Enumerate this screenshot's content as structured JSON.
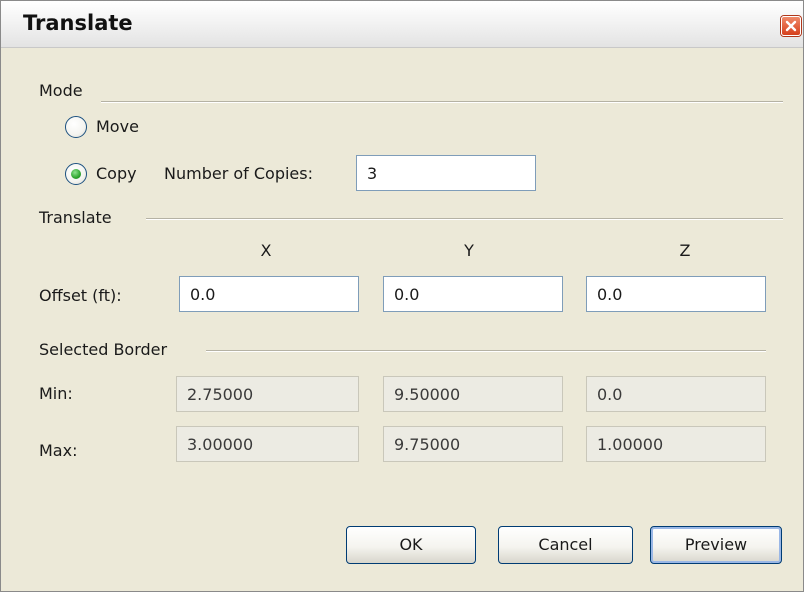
{
  "window": {
    "title": "Translate",
    "close_icon": "close-icon"
  },
  "mode": {
    "group_label": "Mode",
    "move_label": "Move",
    "copy_label": "Copy",
    "selected": "copy",
    "copies_label": "Number of Copies:",
    "copies_value": "3"
  },
  "translate": {
    "group_label": "Translate",
    "axes": [
      "X",
      "Y",
      "Z"
    ],
    "offset_label": "Offset (ft):",
    "offset_values": [
      "0.0",
      "0.0",
      "0.0"
    ]
  },
  "selected_border": {
    "group_label": "Selected Border",
    "min_label": "Min:",
    "min_values": [
      "2.75000",
      "9.50000",
      "0.0"
    ],
    "max_label": "Max:",
    "max_values": [
      "3.00000",
      "9.75000",
      "1.00000"
    ]
  },
  "buttons": {
    "ok": "OK",
    "cancel": "Cancel",
    "preview": "Preview"
  },
  "colors": {
    "dialog_bg": "#ece9d8",
    "close_button": "#d6401c",
    "radio_selected": "#2ea52e",
    "field_border": "#7f9db9",
    "button_border": "#003c74"
  }
}
